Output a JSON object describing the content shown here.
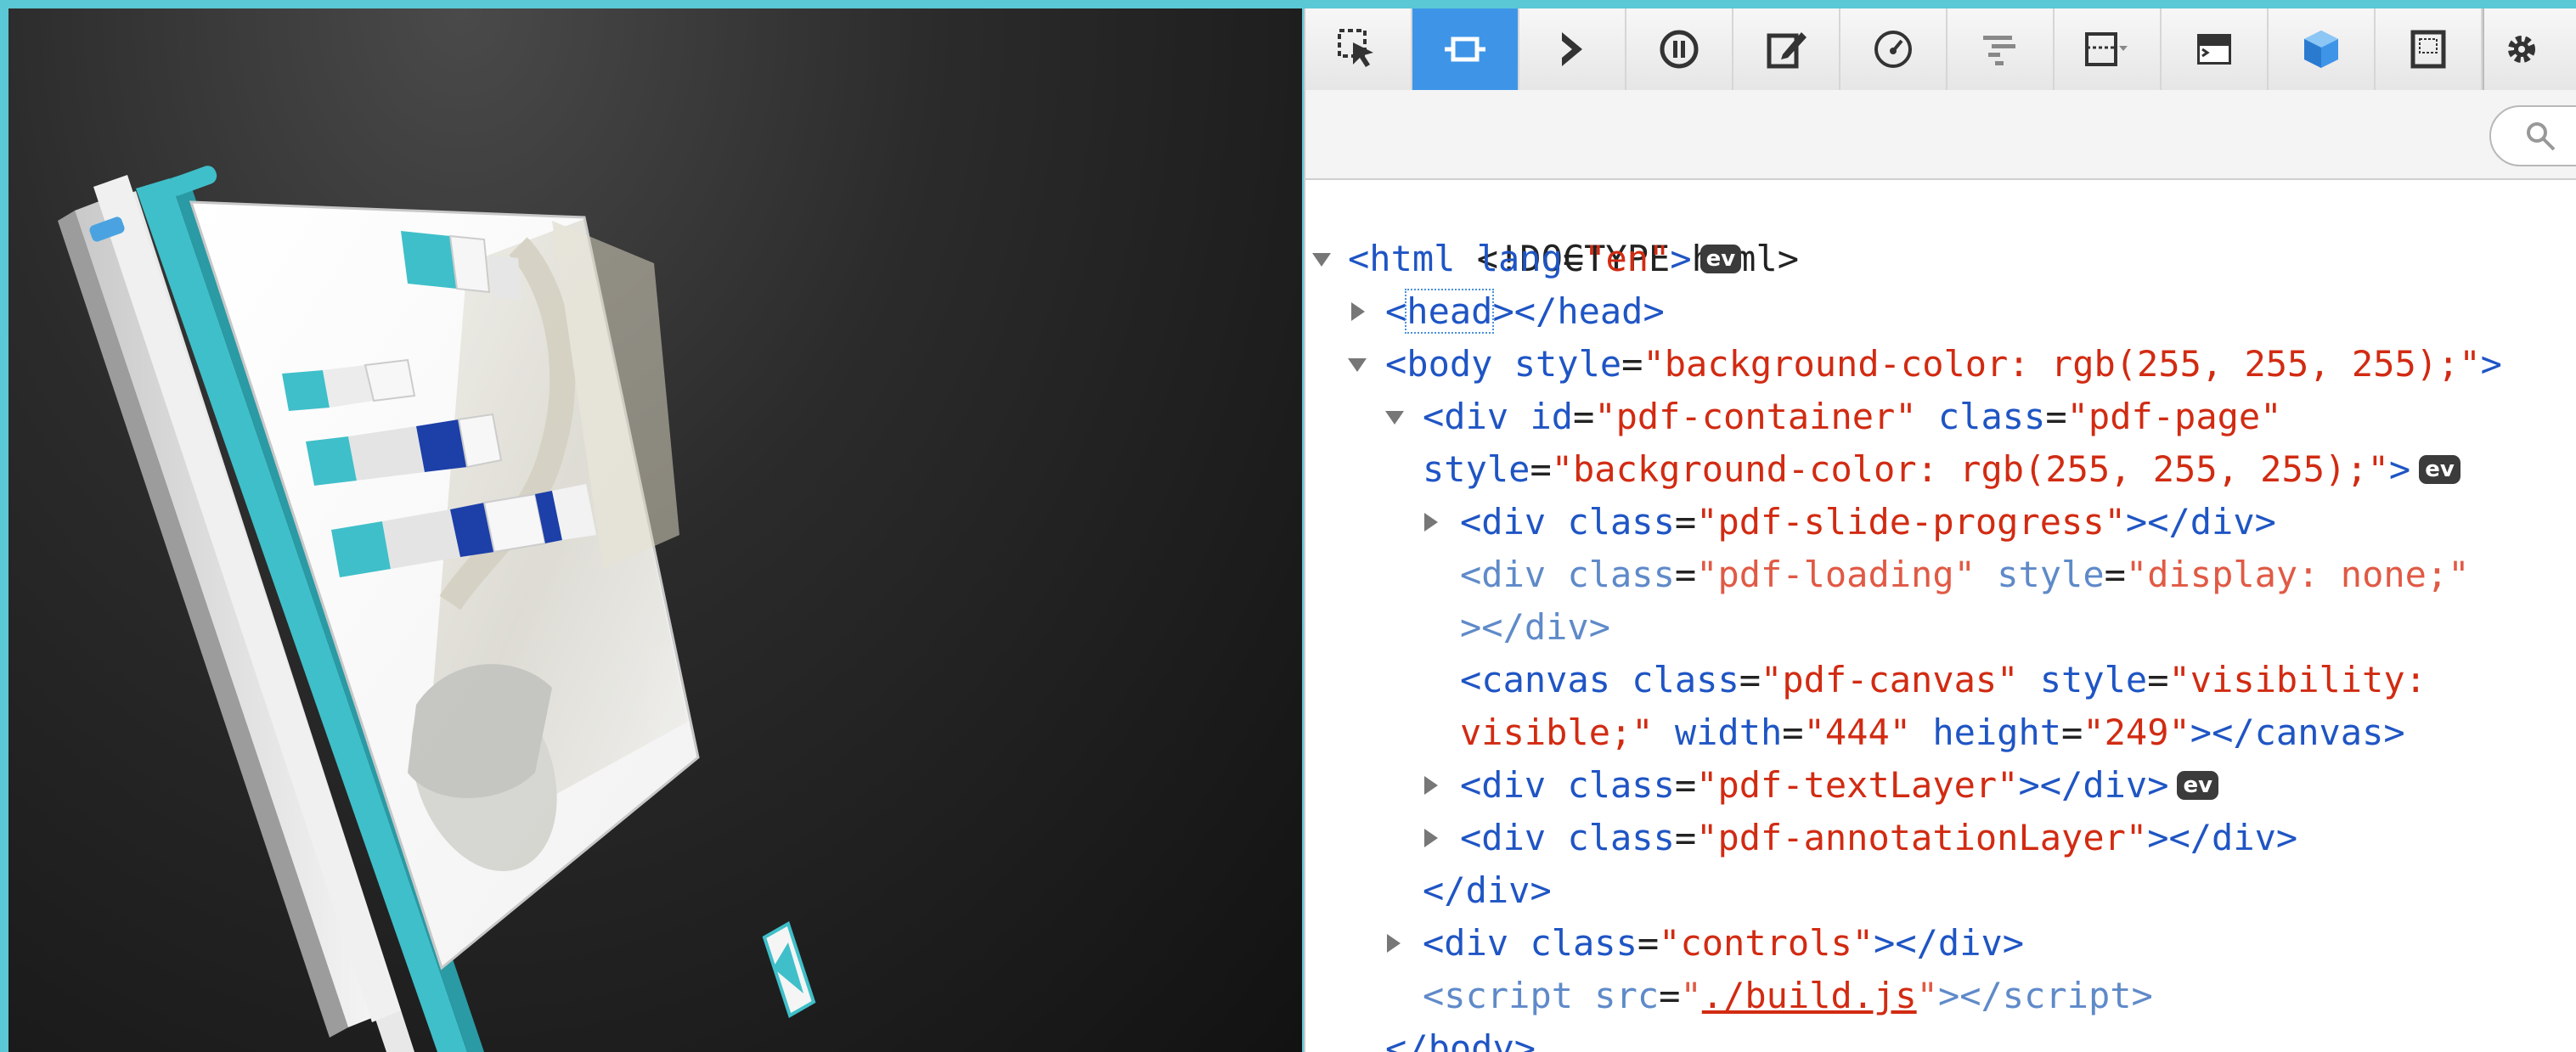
{
  "toolbar": {
    "buttons": [
      {
        "name": "select-element",
        "icon": "cursor-select-icon"
      },
      {
        "name": "pick-element",
        "icon": "crosshair-box-icon",
        "active": true
      },
      {
        "name": "console",
        "icon": "chevron-right-icon"
      },
      {
        "name": "debugger",
        "icon": "pause-circle-icon"
      },
      {
        "name": "style-editor",
        "icon": "edit-pencil-icon"
      },
      {
        "name": "performance",
        "icon": "gauge-icon"
      },
      {
        "name": "network",
        "icon": "waterfall-icon"
      },
      {
        "name": "responsive",
        "icon": "layout-dropdown-icon"
      },
      {
        "name": "scratchpad",
        "icon": "terminal-window-icon"
      },
      {
        "name": "3d-view",
        "icon": "cube-icon"
      },
      {
        "name": "screenshot",
        "icon": "screenshot-frame-icon"
      },
      {
        "name": "settings",
        "icon": "gear-icon"
      }
    ],
    "accent_color": "#3e95e8"
  },
  "search": {
    "icon": "search-icon"
  },
  "dom": {
    "doctype": "<!DOCTYPE html>",
    "html_open_a": "<",
    "html_tag": "html",
    "html_attr": " lang",
    "html_eq": "=",
    "html_val": "\"en\"",
    "html_close": ">",
    "ev": "ev",
    "head_lt": "<",
    "head_tag": "head",
    "head_gt": ">",
    "head_close": "</head",
    "head_end": ">",
    "body_lt": "<",
    "body_tag": "body",
    "body_attr": " style",
    "body_eq": "=",
    "body_val": "\"background-color: rgb(255, 255, 255);\"",
    "body_gt": ">",
    "div1_lt": "<",
    "div1_tag": "div",
    "div1_attr1": " id",
    "div1_eq1": "=",
    "div1_val1": "\"pdf-container\"",
    "div1_attr2": " class",
    "div1_eq2": "=",
    "div1_val2": "\"pdf-page\"",
    "div1_attr3": "style",
    "div1_eq3": "=",
    "div1_val3": "\"background-color: rgb(255, 255, 255);\"",
    "div1_gt": ">",
    "prog_lt": "<",
    "prog_tag": "div",
    "prog_attr": " class",
    "prog_eq": "=",
    "prog_val": "\"pdf-slide-progress\"",
    "prog_gt": "></",
    "prog_close": "div",
    "prog_end": ">",
    "load_lt": "<",
    "load_tag": "div",
    "load_attr1": " class",
    "load_eq1": "=",
    "load_val1": "\"pdf-loading\"",
    "load_attr2": " style",
    "load_eq2": "=",
    "load_val2": "\"display: none;\"",
    "load_line2a": "></",
    "load_line2b": "div",
    "load_line2c": ">",
    "canvas_lt": "<",
    "canvas_tag": "canvas",
    "canvas_attr1": " class",
    "canvas_eq1": "=",
    "canvas_val1": "\"pdf-canvas\"",
    "canvas_attr2": " style",
    "canvas_eq2": "=",
    "canvas_val2a": "\"visibility:",
    "canvas_val2b": "visible;\"",
    "canvas_attr3": " width",
    "canvas_eq3": "=",
    "canvas_val3": "\"444\"",
    "canvas_attr4": " height",
    "canvas_eq4": "=",
    "canvas_val4": "\"249\"",
    "canvas_gt": "></",
    "canvas_close": "canvas",
    "canvas_end": ">",
    "text_lt": "<",
    "text_tag": "div",
    "text_attr": " class",
    "text_eq": "=",
    "text_val": "\"pdf-textLayer\"",
    "text_gt": "></",
    "text_close": "div",
    "text_end": ">",
    "annot_lt": "<",
    "annot_tag": "div",
    "annot_attr": " class",
    "annot_eq": "=",
    "annot_val": "\"pdf-annotationLayer\"",
    "annot_gt": "></",
    "annot_close": "div",
    "annot_end": ">",
    "div1_close_lt": "</",
    "div1_close_tag": "div",
    "div1_close_gt": ">",
    "ctrl_lt": "<",
    "ctrl_tag": "div",
    "ctrl_attr": " class",
    "ctrl_eq": "=",
    "ctrl_val": "\"controls\"",
    "ctrl_gt": "></",
    "ctrl_close": "div",
    "ctrl_end": ">",
    "script_lt": "<",
    "script_tag": "script",
    "script_attr": " src",
    "script_eq": "=",
    "script_q1": "\"",
    "script_link": "./build.js",
    "script_q2": "\"",
    "script_gt": "></",
    "script_close": "script",
    "script_end": ">",
    "body_close_lt": "</",
    "body_close_tag": "body",
    "body_close_gt": ">"
  },
  "scene": {
    "background": "#1c1c1c",
    "layer_color": "#3fbfc9"
  }
}
